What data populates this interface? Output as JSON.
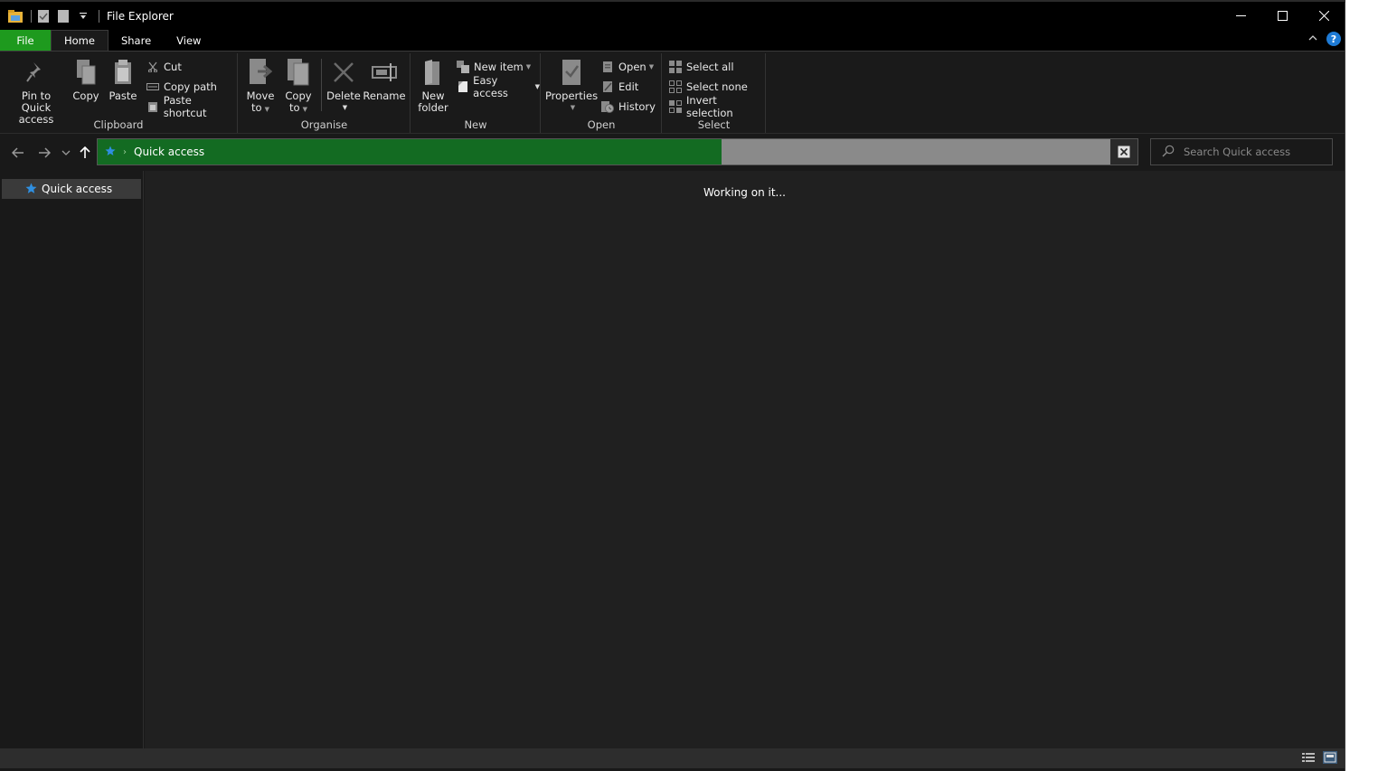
{
  "window": {
    "title": "File Explorer"
  },
  "tabs": [
    {
      "label": "File"
    },
    {
      "label": "Home"
    },
    {
      "label": "Share"
    },
    {
      "label": "View"
    }
  ],
  "ribbon": {
    "clipboard": {
      "pin": "Pin to Quick access",
      "pin_line1": "Pin to Quick",
      "pin_line2": "access",
      "copy": "Copy",
      "paste": "Paste",
      "cut": "Cut",
      "copy_path": "Copy path",
      "paste_shortcut": "Paste shortcut",
      "label": "Clipboard"
    },
    "organise": {
      "move_to_1": "Move",
      "move_to_2": "to",
      "copy_to_1": "Copy",
      "copy_to_2": "to",
      "delete": "Delete",
      "rename": "Rename",
      "label": "Organise"
    },
    "new": {
      "new_folder_1": "New",
      "new_folder_2": "folder",
      "new_item": "New item",
      "easy_access": "Easy access",
      "label": "New"
    },
    "open": {
      "properties": "Properties",
      "open": "Open",
      "edit": "Edit",
      "history": "History",
      "label": "Open"
    },
    "select": {
      "select_all": "Select all",
      "select_none": "Select none",
      "invert_selection": "Invert selection",
      "label": "Select"
    }
  },
  "address": {
    "location": "Quick access",
    "progress": 0.6
  },
  "search": {
    "placeholder": "Search Quick access"
  },
  "navpane": {
    "items": [
      {
        "label": "Quick access"
      }
    ]
  },
  "content": {
    "status_message": "Working on it..."
  },
  "colors": {
    "file_tab": "#1e9a1e",
    "progress": "#136b22",
    "star": "#2f8fe0"
  }
}
